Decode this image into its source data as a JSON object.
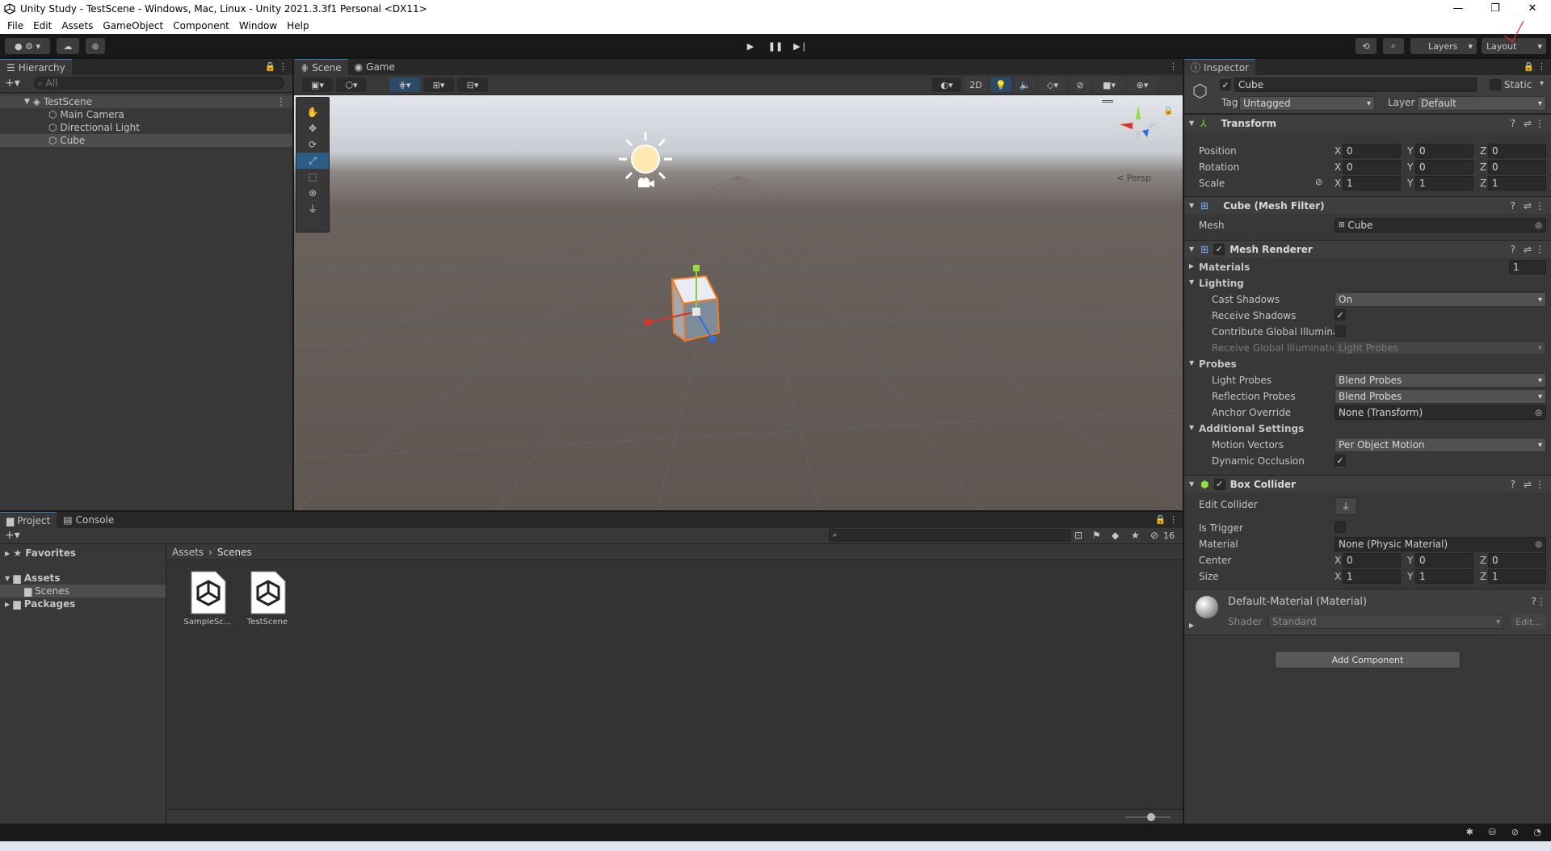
{
  "window": {
    "title": "Unity Study - TestScene - Windows, Mac, Linux - Unity 2021.3.3f1 Personal <DX11>",
    "min": "—",
    "max": "❐",
    "close": "✕"
  },
  "menu": [
    "File",
    "Edit",
    "Assets",
    "GameObject",
    "Component",
    "Window",
    "Help"
  ],
  "toolbar": {
    "layers_label": "Layers",
    "layout_label": "Layout"
  },
  "hierarchy": {
    "tab": "Hierarchy",
    "search_placeholder": "All",
    "scene": "TestScene",
    "items": [
      "Main Camera",
      "Directional Light",
      "Cube"
    ]
  },
  "scene_view": {
    "tabs": [
      "Scene",
      "Game"
    ],
    "mode_2d": "2D",
    "persp_label": "< Persp"
  },
  "project": {
    "tabs": [
      "Project",
      "Console"
    ],
    "favorites": "Favorites",
    "assets": "Assets",
    "scenes": "Scenes",
    "packages": "Packages",
    "breadcrumb": [
      "Assets",
      "Scenes"
    ],
    "hidden_count": "16",
    "files": [
      "SampleSc...",
      "TestScene"
    ]
  },
  "inspector": {
    "tab": "Inspector",
    "object_name": "Cube",
    "static_label": "Static",
    "tag_label": "Tag",
    "tag_value": "Untagged",
    "layer_label": "Layer",
    "layer_value": "Default",
    "transform": {
      "title": "Transform",
      "rows": [
        {
          "label": "Position",
          "x": "0",
          "y": "0",
          "z": "0"
        },
        {
          "label": "Rotation",
          "x": "0",
          "y": "0",
          "z": "0"
        },
        {
          "label": "Scale",
          "x": "1",
          "y": "1",
          "z": "1"
        }
      ]
    },
    "mesh_filter": {
      "title": "Cube (Mesh Filter)",
      "mesh_label": "Mesh",
      "mesh_value": "Cube"
    },
    "mesh_renderer": {
      "title": "Mesh Renderer",
      "materials_label": "Materials",
      "materials_count": "1",
      "lighting_label": "Lighting",
      "cast_shadows_label": "Cast Shadows",
      "cast_shadows_value": "On",
      "receive_shadows_label": "Receive Shadows",
      "contribute_gi_label": "Contribute Global Illuminat",
      "receive_gi_label": "Receive Global Illuminatior",
      "receive_gi_value": "Light Probes",
      "probes_label": "Probes",
      "light_probes_label": "Light Probes",
      "light_probes_value": "Blend Probes",
      "reflection_probes_label": "Reflection Probes",
      "reflection_probes_value": "Blend Probes",
      "anchor_override_label": "Anchor Override",
      "anchor_override_value": "None (Transform)",
      "additional_label": "Additional Settings",
      "motion_vectors_label": "Motion Vectors",
      "motion_vectors_value": "Per Object Motion",
      "dynamic_occlusion_label": "Dynamic Occlusion"
    },
    "box_collider": {
      "title": "Box Collider",
      "edit_collider_label": "Edit Collider",
      "is_trigger_label": "Is Trigger",
      "material_label": "Material",
      "material_value": "None (Physic Material)",
      "center_label": "Center",
      "center": {
        "x": "0",
        "y": "0",
        "z": "0"
      },
      "size_label": "Size",
      "size": {
        "x": "1",
        "y": "1",
        "z": "1"
      }
    },
    "material": {
      "title": "Default-Material (Material)",
      "shader_label": "Shader",
      "shader_value": "Standard",
      "edit_label": "Edit..."
    },
    "add_component": "Add Component"
  },
  "colors": {
    "accent": "#3a79bb",
    "panel": "#383838",
    "selection": "#2c5d87",
    "orange": "#f47b20"
  }
}
